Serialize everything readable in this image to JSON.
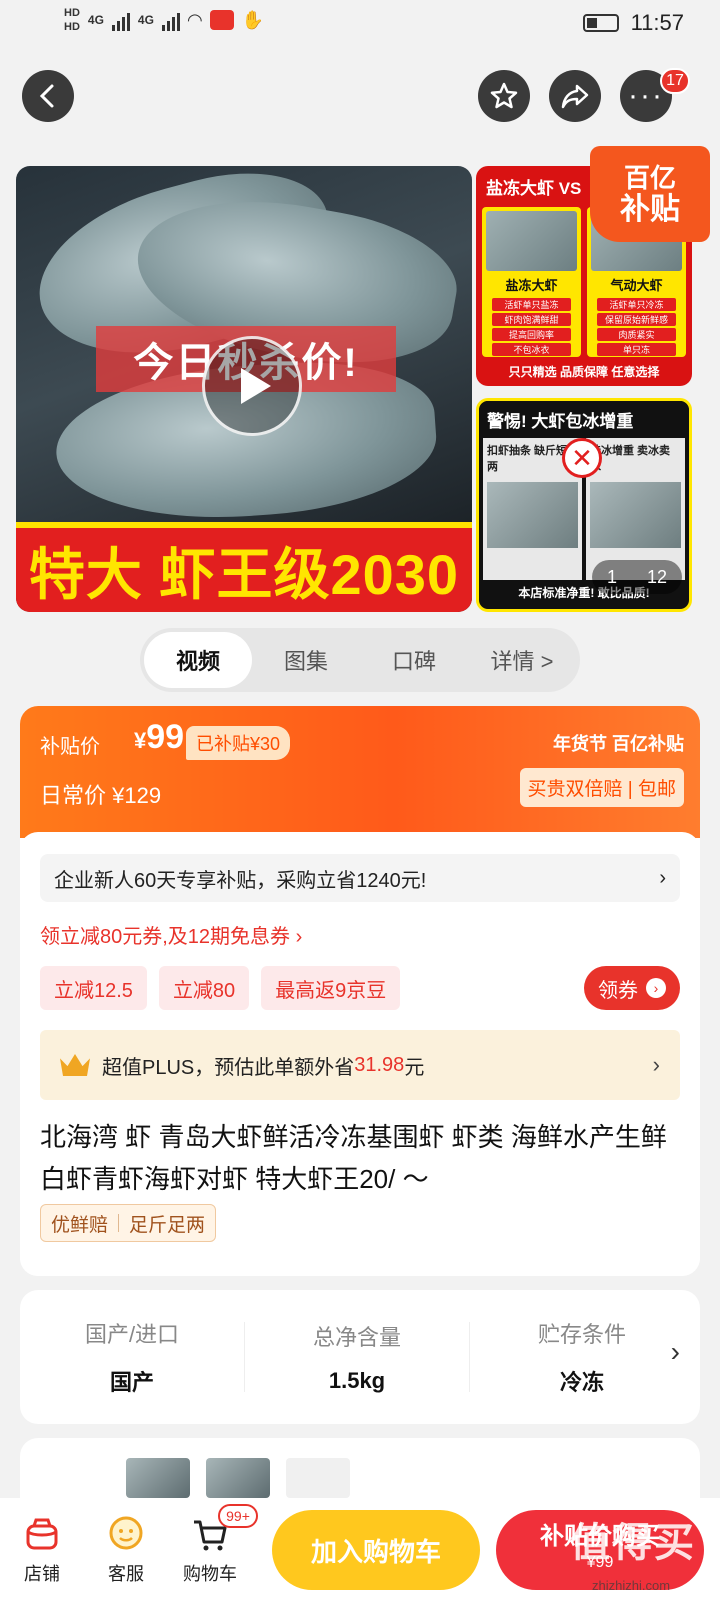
{
  "status_bar": {
    "hd1": "HD",
    "hd2": "HD",
    "net1": "4G",
    "net2": "4G",
    "time": "11:57"
  },
  "top_nav": {
    "more_badge": "17"
  },
  "main_image": {
    "banner": "今日秒杀价!",
    "bottom_text": "特大 虾王级2030"
  },
  "side_image_1": {
    "title": "盐冻大虾 VS",
    "left_name": "盐冻大虾",
    "left_tags": [
      "活虾单只盐冻",
      "虾肉饱满鲜甜",
      "提高回购率",
      "不包冰衣"
    ],
    "right_name": "气动大虾",
    "right_tags": [
      "活虾单只冷冻",
      "保留原始新鲜感",
      "肉质紧实",
      "单只冻"
    ],
    "footer": "只只精选  品质保障  任意选择"
  },
  "subsidy_corner": {
    "line1": "百亿",
    "line2": "补贴"
  },
  "side_image_2": {
    "title": "警惕! 大虾包冰增重",
    "left_box": "扣虾抽条 缺斤短两",
    "right_box": "挂冰增重 卖冰卖水",
    "footer": "本店标准净重! 敢比品质!"
  },
  "image_counter": {
    "current": "1",
    "total": "12"
  },
  "tabs": [
    {
      "label": "视频",
      "active": true
    },
    {
      "label": "图集",
      "active": false
    },
    {
      "label": "口碑",
      "active": false
    },
    {
      "label": "详情 >",
      "active": false
    }
  ],
  "price": {
    "subsidy_label": "补贴价",
    "currency": "¥",
    "subsidy_price": "99",
    "subsidy_tag": "已补贴¥30",
    "daily_label": "日常价 ¥129",
    "right_title": "年货节 百亿补贴",
    "guarantee": "买贵双倍赔 | 包邮"
  },
  "enterprise_text": "企业新人60天专享补贴，采购立省1240元!",
  "coupon_line": "领立减80元券,及12期免息券 ›",
  "chips": [
    "立减12.5",
    "立减80",
    "最高返9京豆"
  ],
  "get_coupon": "领券",
  "plus": {
    "prefix": "超值PLUS，预估此单额外省",
    "amount": "31.98",
    "suffix": "元"
  },
  "product_title": "北海湾 虾 青岛大虾鲜活冷冻基围虾 虾类 海鲜水产生鲜白虾青虾海虾对虾 特大虾王20/ ～",
  "tags": [
    "优鲜赔",
    "足斤足两"
  ],
  "specs": [
    {
      "key": "国产/进口",
      "value": "国产"
    },
    {
      "key": "总净含量",
      "value": "1.5kg"
    },
    {
      "key": "贮存条件",
      "value": "冷冻"
    }
  ],
  "bottom_nav": [
    {
      "label": "店铺",
      "icon": "store-icon"
    },
    {
      "label": "客服",
      "icon": "service-icon"
    },
    {
      "label": "购物车",
      "icon": "cart-icon",
      "badge": "99+"
    }
  ],
  "add_to_cart": "加入购物车",
  "buy_now": {
    "label": "补贴价购买",
    "price": "¥99"
  },
  "watermark": {
    "text": "值得买",
    "url": "zhizhizhi.com"
  },
  "colors": {
    "brand_red": "#e8332b",
    "orange": "#ff5a1a",
    "yellow_button": "#ffc81e"
  }
}
